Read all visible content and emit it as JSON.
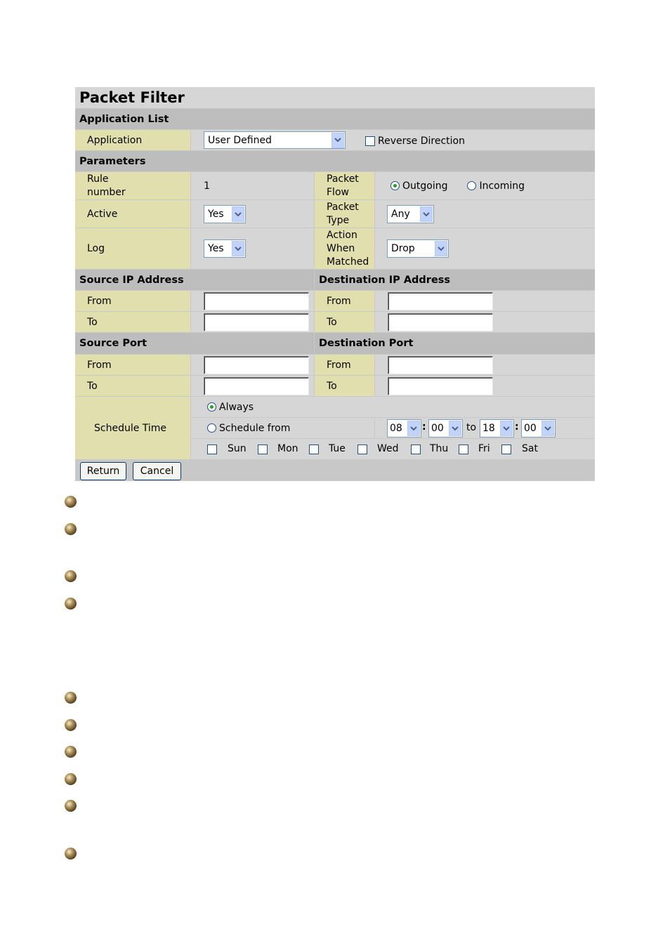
{
  "title": "Packet Filter",
  "sections": {
    "application_list": "Application List",
    "parameters": "Parameters",
    "source_ip": "Source IP Address",
    "dest_ip": "Destination IP Address",
    "source_port": "Source Port",
    "dest_port": "Destination Port"
  },
  "application": {
    "label": "Application",
    "value": "User Defined",
    "reverse_label": "Reverse Direction"
  },
  "rule": {
    "label_l1": "Rule",
    "label_l2": "number",
    "value": "1"
  },
  "packet_flow": {
    "label_l1": "Packet",
    "label_l2": "Flow",
    "outgoing": "Outgoing",
    "incoming": "Incoming"
  },
  "active": {
    "label": "Active",
    "value": "Yes"
  },
  "packet_type": {
    "label_l1": "Packet",
    "label_l2": "Type",
    "value": "Any"
  },
  "log": {
    "label": "Log",
    "value": "Yes"
  },
  "action": {
    "label_l1": "Action",
    "label_l2": "When",
    "label_l3": "Matched",
    "value": "Drop"
  },
  "labels": {
    "from": "From",
    "to": "To"
  },
  "schedule": {
    "label": "Schedule Time",
    "always": "Always",
    "from_label": "Schedule from",
    "start_hour": "08",
    "start_min": "00",
    "to_word": "to",
    "end_hour": "18",
    "end_min": "00",
    "colon": ":",
    "days": [
      "Sun",
      "Mon",
      "Tue",
      "Wed",
      "Thu",
      "Fri",
      "Sat"
    ]
  },
  "buttons": {
    "return": "Return",
    "cancel": "Cancel"
  },
  "icons": {
    "dropdown": "chevron-down-icon",
    "bullet": "bullet-icon"
  },
  "colors": {
    "label_bg": "#e2dfae",
    "header_bg": "#bdbdbd",
    "row_bg": "#d6d6d6"
  }
}
